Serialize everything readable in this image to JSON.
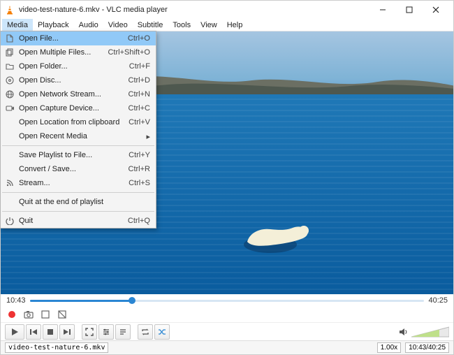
{
  "titlebar": {
    "title": "video-test-nature-6.mkv - VLC media player"
  },
  "menubar": {
    "items": [
      "Media",
      "Playback",
      "Audio",
      "Video",
      "Subtitle",
      "Tools",
      "View",
      "Help"
    ]
  },
  "dropdown": {
    "groups": [
      [
        {
          "icon": "file-icon",
          "label": "Open File...",
          "shortcut": "Ctrl+O",
          "highlight": true
        },
        {
          "icon": "files-icon",
          "label": "Open Multiple Files...",
          "shortcut": "Ctrl+Shift+O"
        },
        {
          "icon": "folder-icon",
          "label": "Open Folder...",
          "shortcut": "Ctrl+F"
        },
        {
          "icon": "disc-icon",
          "label": "Open Disc...",
          "shortcut": "Ctrl+D"
        },
        {
          "icon": "network-icon",
          "label": "Open Network Stream...",
          "shortcut": "Ctrl+N"
        },
        {
          "icon": "capture-icon",
          "label": "Open Capture Device...",
          "shortcut": "Ctrl+C"
        },
        {
          "icon": "",
          "label": "Open Location from clipboard",
          "shortcut": "Ctrl+V"
        },
        {
          "icon": "",
          "label": "Open Recent Media",
          "shortcut": "",
          "submenu": true
        }
      ],
      [
        {
          "icon": "",
          "label": "Save Playlist to File...",
          "shortcut": "Ctrl+Y"
        },
        {
          "icon": "",
          "label": "Convert / Save...",
          "shortcut": "Ctrl+R"
        },
        {
          "icon": "stream-icon",
          "label": "Stream...",
          "shortcut": "Ctrl+S"
        }
      ],
      [
        {
          "icon": "",
          "label": "Quit at the end of playlist",
          "shortcut": ""
        }
      ],
      [
        {
          "icon": "quit-icon",
          "label": "Quit",
          "shortcut": "Ctrl+Q"
        }
      ]
    ]
  },
  "time": {
    "current": "10:43",
    "total": "40:25",
    "progress_pct": 26
  },
  "status": {
    "file": "video-test-nature-6.mkv",
    "speed": "1.00x",
    "time_display": "10:43/40:25"
  },
  "colors": {
    "accent": "#2a86d3"
  }
}
